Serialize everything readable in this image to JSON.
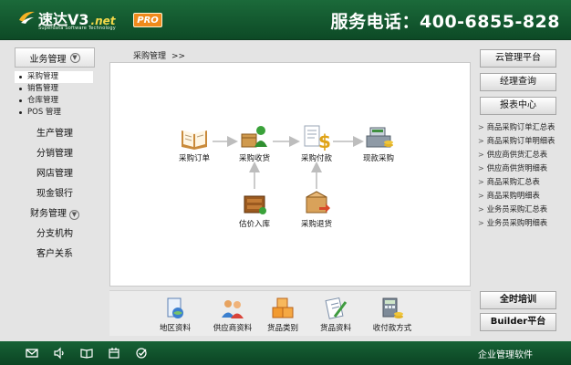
{
  "header": {
    "logo_name": "速达V3",
    "logo_net": ".net",
    "logo_sub": "Superdata Software Technology",
    "pro_badge": "PRO",
    "phone": "服务电话：400-6855-828"
  },
  "sidebar": {
    "purchase_head": "业务管理",
    "submenu": [
      "采购管理",
      "销售管理",
      "仓库管理",
      "POS 管理"
    ],
    "items": [
      "生产管理",
      "分销管理",
      "网店管理",
      "现金银行",
      "财务管理",
      "分支机构",
      "客户关系"
    ]
  },
  "breadcrumb": {
    "label": "采购管理",
    "sep": ">>"
  },
  "flow": {
    "nodes": {
      "order": "采购订单",
      "receive": "采购收货",
      "payment": "采购付款",
      "cash_purchase": "现款采购",
      "valuation": "估价入库",
      "return": "采购退货"
    },
    "colors": {
      "arrow": "#cccccc"
    }
  },
  "quick": {
    "items": [
      "地区资料",
      "供应商资料",
      "货品类别",
      "货品资料",
      "收付款方式"
    ]
  },
  "right": {
    "buttons": [
      "云管理平台",
      "经理查询",
      "报表中心"
    ],
    "links": [
      "商品采购订单汇总表",
      "商品采购订单明细表",
      "供应商供货汇总表",
      "供应商供货明细表",
      "商品采购汇总表",
      "商品采购明细表",
      "业务员采购汇总表",
      "业务员采购明细表"
    ],
    "bottom_buttons": [
      "全时培训",
      "Builder平台"
    ]
  },
  "footer": {
    "icons": [
      "mail-icon",
      "speaker-icon",
      "book-icon",
      "calendar-icon",
      "check-icon"
    ],
    "text": "企业管理软件"
  }
}
